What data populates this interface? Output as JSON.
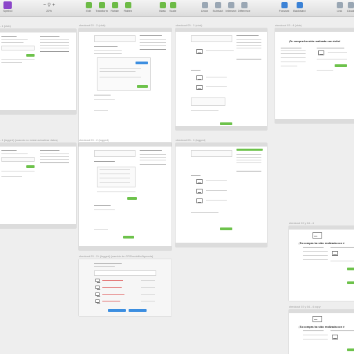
{
  "toolbar": {
    "symbol_label": "Symbol",
    "zoom_value": "22%",
    "tools": [
      {
        "label": "Edit",
        "icon": "edit-icon",
        "color": "#6dbb46"
      },
      {
        "label": "Transform",
        "icon": "transform-icon",
        "color": "#6dbb46"
      },
      {
        "label": "Rotate",
        "icon": "rotate-icon",
        "color": "#6dbb46"
      },
      {
        "label": "Flatten",
        "icon": "flatten-icon",
        "color": "#6dbb46"
      },
      {
        "label": "Mask",
        "icon": "mask-icon",
        "color": "#6dbb46"
      },
      {
        "label": "Scale",
        "icon": "scale-icon",
        "color": "#6dbb46"
      },
      {
        "label": "Union",
        "icon": "union-icon",
        "color": "#9aa7b4"
      },
      {
        "label": "Subtract",
        "icon": "subtract-icon",
        "color": "#9aa7b4"
      },
      {
        "label": "Intersect",
        "icon": "intersect-icon",
        "color": "#9aa7b4"
      },
      {
        "label": "Difference",
        "icon": "difference-icon",
        "color": "#9aa7b4"
      },
      {
        "label": "Forward",
        "icon": "forward-icon",
        "color": "#3b82d6"
      },
      {
        "label": "Backward",
        "icon": "backward-icon",
        "color": "#3b82d6"
      },
      {
        "label": "Link",
        "icon": "link-icon",
        "color": "#9aa7b4"
      },
      {
        "label": "Cloud",
        "icon": "cloud-icon",
        "color": "#9aa7b4"
      }
    ]
  },
  "artboards": {
    "a1": {
      "title": "- 1 (club)"
    },
    "a2": {
      "title": "checkout 03 - 2 (club)"
    },
    "a3": {
      "title": "checkout 03 - 3 (club)"
    },
    "a4": {
      "title": "checkout 03 - 4 (club)",
      "headline": "¡Tu compra ha sido realizada con éxito!"
    },
    "a5": {
      "title": "- 1 (logged) (cuando no existe actualizar datos)"
    },
    "a6": {
      "title": "checkout 03 - 2 (logged)"
    },
    "a7": {
      "title": "checkout 03 - 3 (logged)"
    },
    "a8": {
      "title": "checkout 03 y 04 - 4",
      "headline": "¡Tu compra ha sido realizada con é"
    },
    "a9": {
      "title": "checkout 03 - 2+ (logged) (cambio de CP/Domicilio/Agencia)"
    },
    "a10": {
      "title": "checkout 03 y 04 - 4 copy",
      "headline": "¡Tu compra ha sido realizada con é"
    }
  }
}
